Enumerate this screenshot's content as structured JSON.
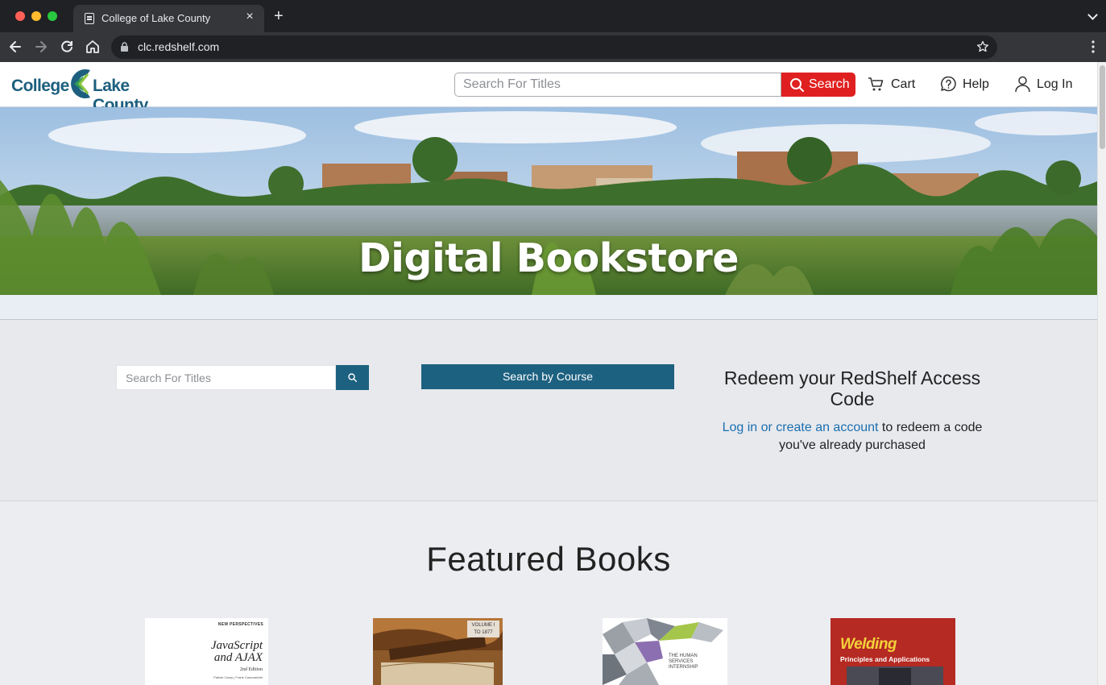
{
  "browser": {
    "tab_title": "College of Lake County",
    "url": "clc.redshelf.com",
    "icons": {
      "tab_close": "close-icon",
      "new_tab": "plus-icon",
      "back": "arrow-left-icon",
      "forward": "arrow-right-icon",
      "reload": "reload-icon",
      "home": "home-icon",
      "lock": "lock-icon",
      "bookmark": "star-icon",
      "menu": "kebab-menu-icon"
    },
    "close_glyph": "×",
    "new_tab_glyph": "+"
  },
  "header": {
    "logo_left": "College",
    "logo_right": "Lake County",
    "search_placeholder": "Search For Titles",
    "search_button": "Search",
    "cart": "Cart",
    "help": "Help",
    "login": "Log In",
    "colors": {
      "search_button": "#e02020",
      "logo": "#1d5f7e"
    }
  },
  "hero": {
    "title": "Digital Bookstore"
  },
  "panel": {
    "search_placeholder": "Search For Titles",
    "course_button": "Search by Course",
    "redeem_title": "Redeem your RedShelf Access Code",
    "redeem_link": "Log in or create an account",
    "redeem_rest": " to redeem a code you've already purchased",
    "colors": {
      "primary": "#1d6180",
      "link": "#1a6fb0"
    }
  },
  "featured": {
    "title": "Featured Books",
    "books": [
      {
        "series": "NEW PERSPECTIVES",
        "title_line1": "JavaScript",
        "title_line2": "and AJAX",
        "edition": "2nd Edition",
        "authors": "Patrick Carey | Frank Canovatchel"
      },
      {
        "volume_line1": "VOLUME I",
        "volume_line2": "TO 1877"
      },
      {
        "title_line1": "THE HUMAN SERVICES",
        "title_line2": "INTERNSHIP"
      },
      {
        "title": "Welding",
        "subtitle": "Principles and Applications"
      }
    ]
  }
}
